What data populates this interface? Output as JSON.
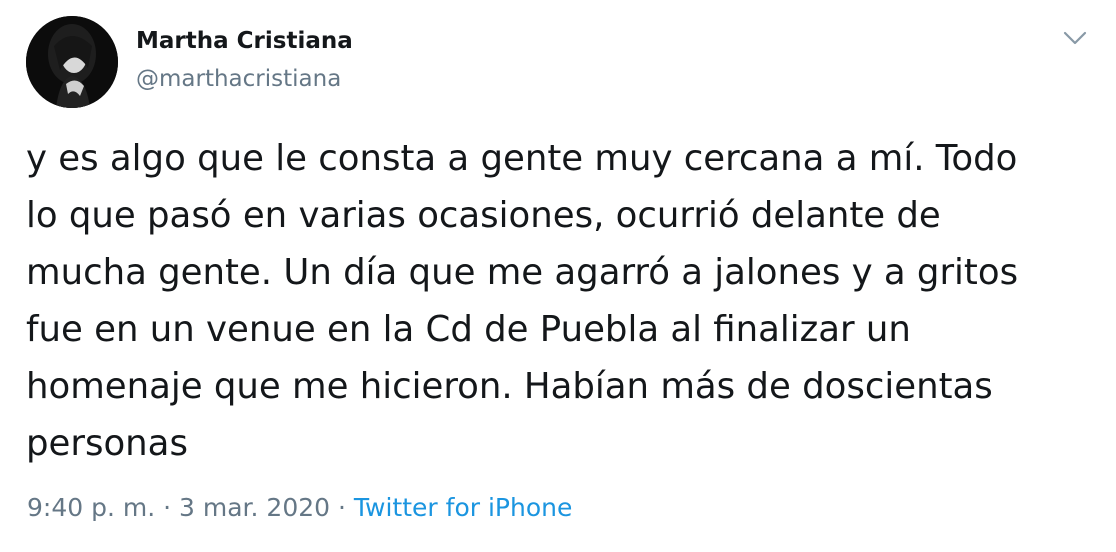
{
  "author": {
    "display_name": "Martha Cristiana",
    "handle": "@marthacristiana"
  },
  "tweet": {
    "lines": [
      "y es algo que le consta a gente muy cercana a mí. Todo",
      "lo que pasó en varias ocasiones, ocurrió delante de",
      "mucha gente. Un día que me agarró a jalones y a gritos",
      "fue en un venue en la Cd de Puebla al finalizar un",
      "homenaje que me hicieron. Habían más de doscientas",
      "personas"
    ]
  },
  "meta": {
    "time": "9:40 p. m.",
    "separator": "·",
    "date": "3 mar. 2020",
    "source": "Twitter for iPhone"
  },
  "icons": {
    "menu": "chevron-down-icon"
  },
  "colors": {
    "text": "#14171a",
    "secondary": "#657786",
    "link": "#1b95e0"
  }
}
